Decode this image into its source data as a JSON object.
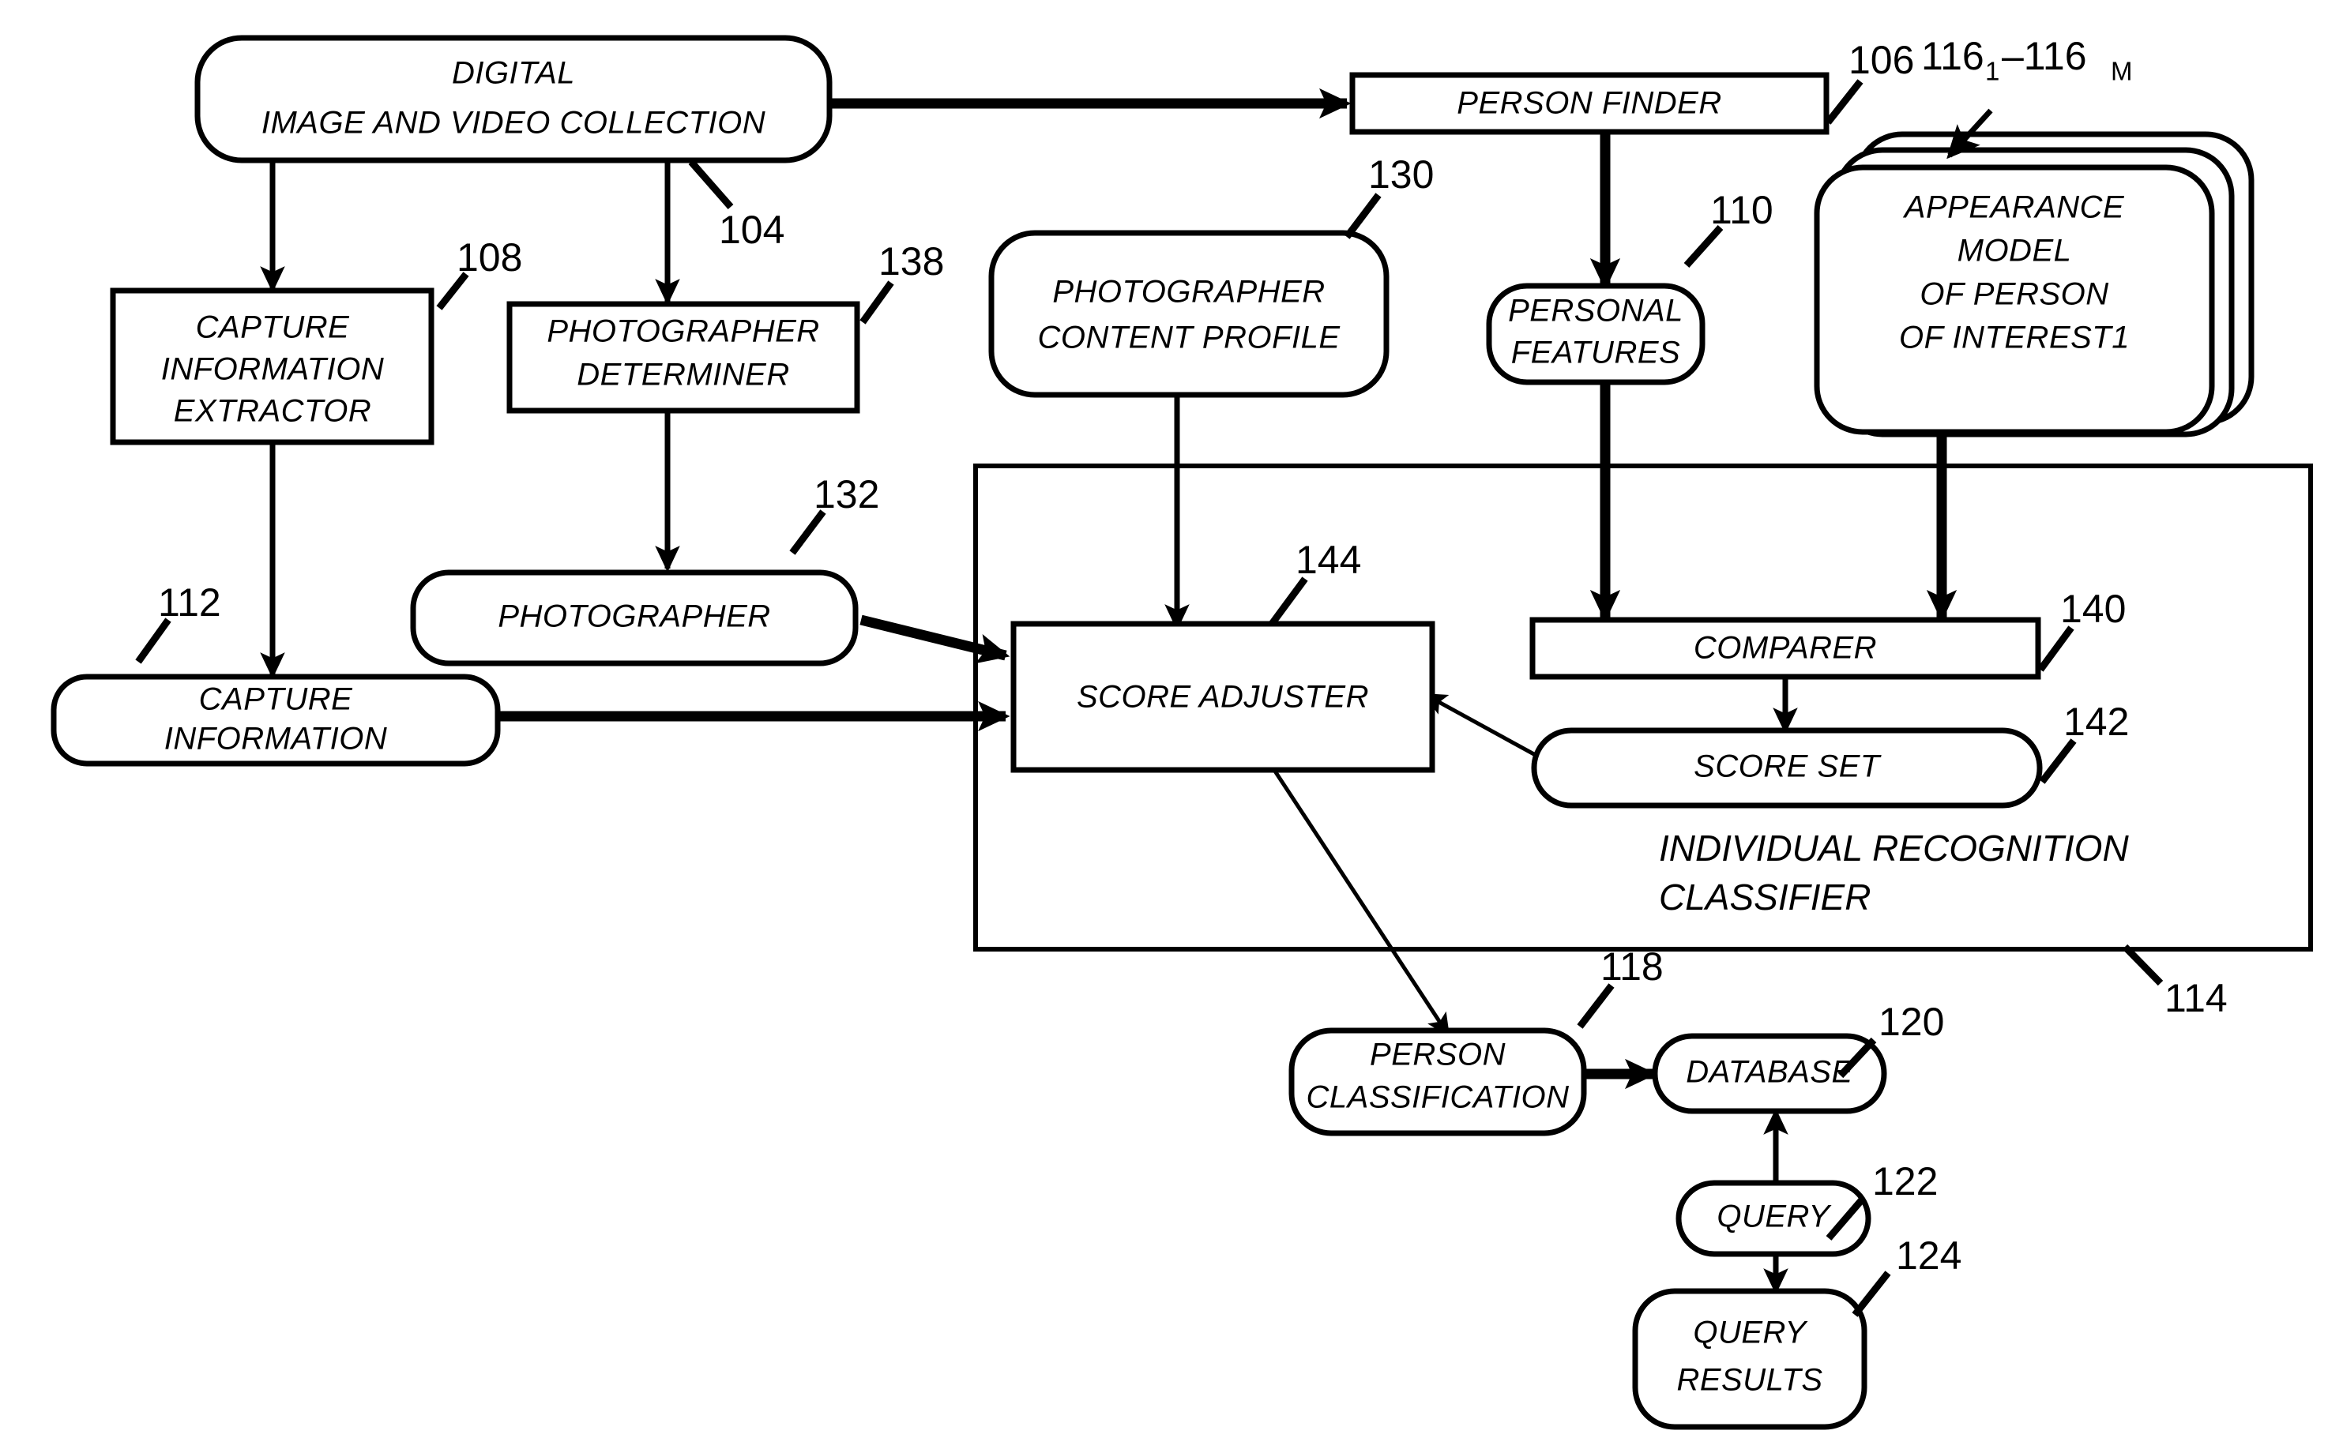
{
  "figure": {
    "title": "Person recognition system block diagram",
    "nodes": {
      "digital_collection": {
        "line1": "DIGITAL",
        "line2": "IMAGE AND VIDEO COLLECTION",
        "ref": "104"
      },
      "capture_info_extractor": {
        "line1": "CAPTURE",
        "line2": "INFORMATION",
        "line3": "EXTRACTOR",
        "ref": "108"
      },
      "photographer_determiner": {
        "line1": "PHOTOGRAPHER",
        "line2": "DETERMINER",
        "ref": "138"
      },
      "photographer_content_profile": {
        "line1": "PHOTOGRAPHER",
        "line2": "CONTENT PROFILE",
        "ref": "130"
      },
      "person_finder": {
        "line1": "PERSON FINDER",
        "ref": "106"
      },
      "personal_features": {
        "line1": "PERSONAL",
        "line2": "FEATURES",
        "ref": "110"
      },
      "appearance_model": {
        "line1": "APPEARANCE",
        "line2": "MODEL",
        "line3": "OF PERSON",
        "line4": "OF INTEREST1",
        "ref_main": "116",
        "ref_sub1": "1",
        "ref_dash": "–116",
        "ref_sub2": "M"
      },
      "capture_information": {
        "line1": "CAPTURE",
        "line2": "INFORMATION",
        "ref": "112"
      },
      "photographer": {
        "line1": "PHOTOGRAPHER",
        "ref": "132"
      },
      "score_adjuster": {
        "line1": "SCORE ADJUSTER",
        "ref": "144"
      },
      "comparer": {
        "line1": "COMPARER",
        "ref": "140"
      },
      "score_set": {
        "line1": "SCORE SET",
        "ref": "142"
      },
      "individual_recognition_classifier": {
        "line1": "INDIVIDUAL RECOGNITION",
        "line2": "CLASSIFIER",
        "ref": "114"
      },
      "person_classification": {
        "line1": "PERSON",
        "line2": "CLASSIFICATION",
        "ref": "118"
      },
      "database": {
        "line1": "DATABASE",
        "ref": "120"
      },
      "query": {
        "line1": "QUERY",
        "ref": "122"
      },
      "query_results": {
        "line1": "QUERY",
        "line2": "RESULTS",
        "ref": "124"
      }
    },
    "colors": {
      "ink": "#000000",
      "paper": "#ffffff"
    }
  }
}
